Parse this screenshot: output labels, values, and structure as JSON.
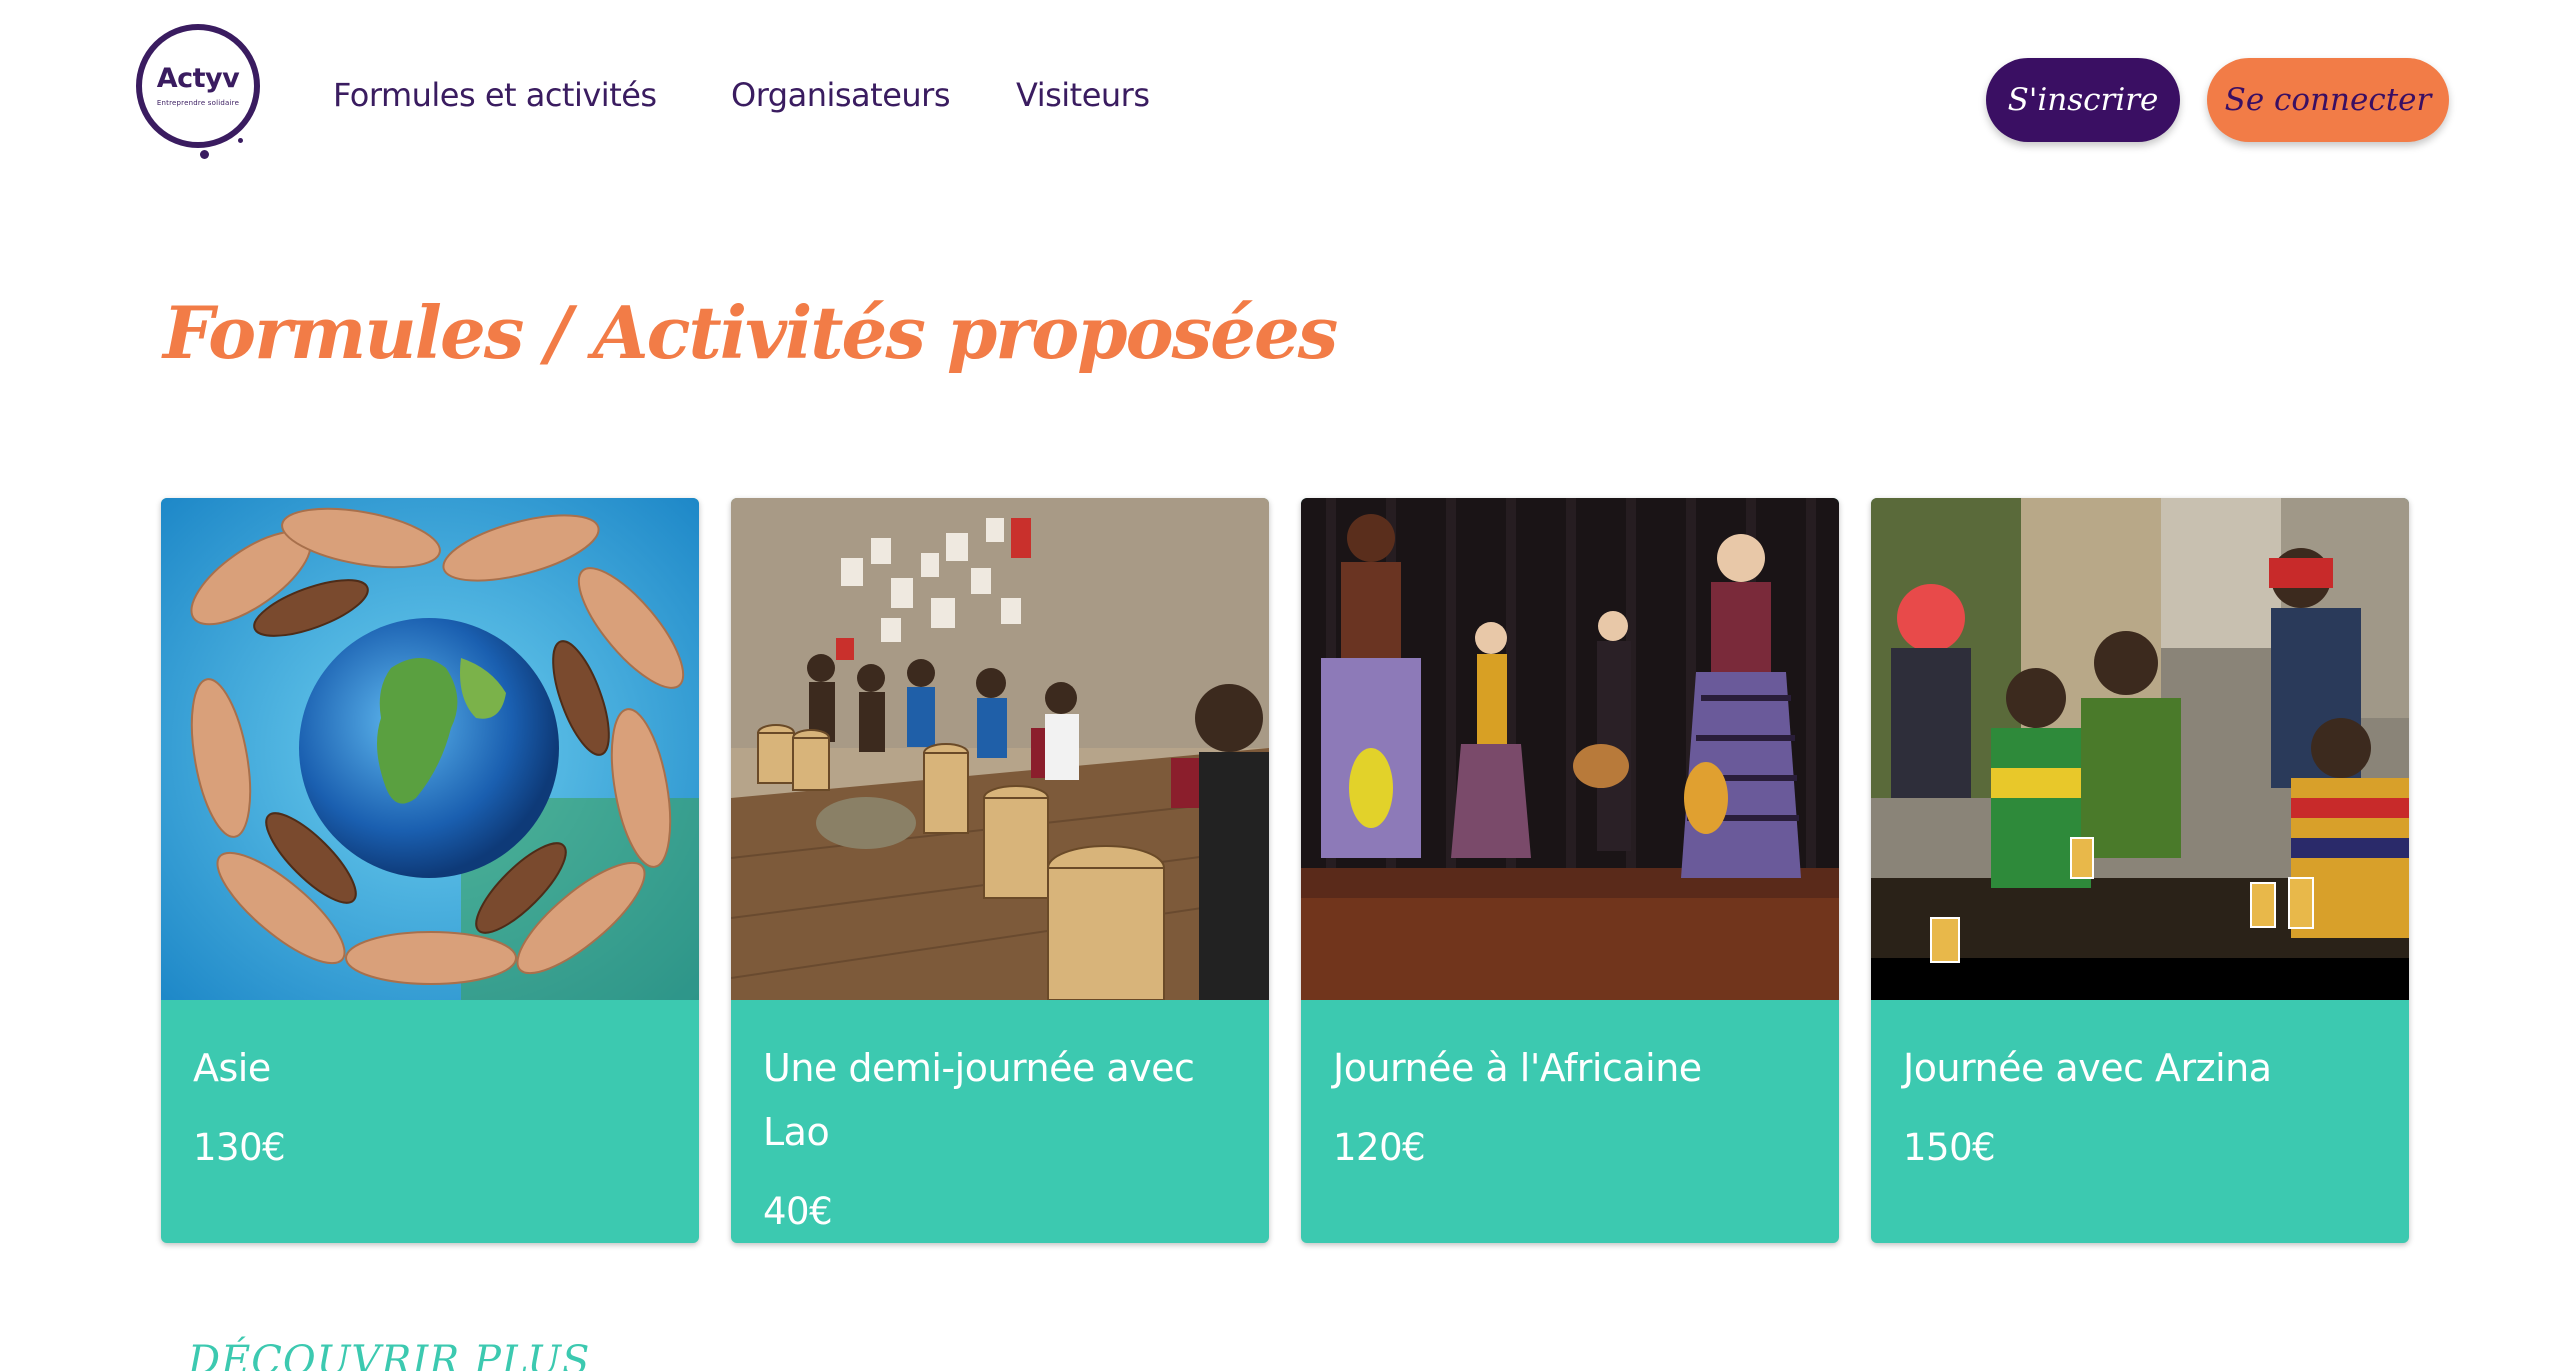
{
  "header": {
    "logo_text": "Actyv",
    "logo_subtitle": "Entreprendre solidaire",
    "nav": [
      {
        "label": "Formules et activités"
      },
      {
        "label": "Organisateurs"
      },
      {
        "label": "Visiteurs"
      }
    ],
    "signup_label": "S'inscrire",
    "login_label": "Se connecter"
  },
  "main": {
    "title": "Formules / Activités proposées",
    "cards": [
      {
        "title": "Asie",
        "price": "130€",
        "image": "hands-around-globe-photo"
      },
      {
        "title": "Une demi-journée avec Lao",
        "price": "40€",
        "image": "drum-circle-photo"
      },
      {
        "title": "Journée à l'Africaine",
        "price": "120€",
        "image": "stage-dancers-photo"
      },
      {
        "title": "Journée avec Arzina",
        "price": "150€",
        "image": "street-cafe-photo"
      }
    ],
    "discover_label": "DÉCOUVRIR PLUS"
  },
  "colors": {
    "brand_purple": "#3a0f63",
    "accent_orange": "#f27c47",
    "card_teal": "#3cc9b0"
  }
}
